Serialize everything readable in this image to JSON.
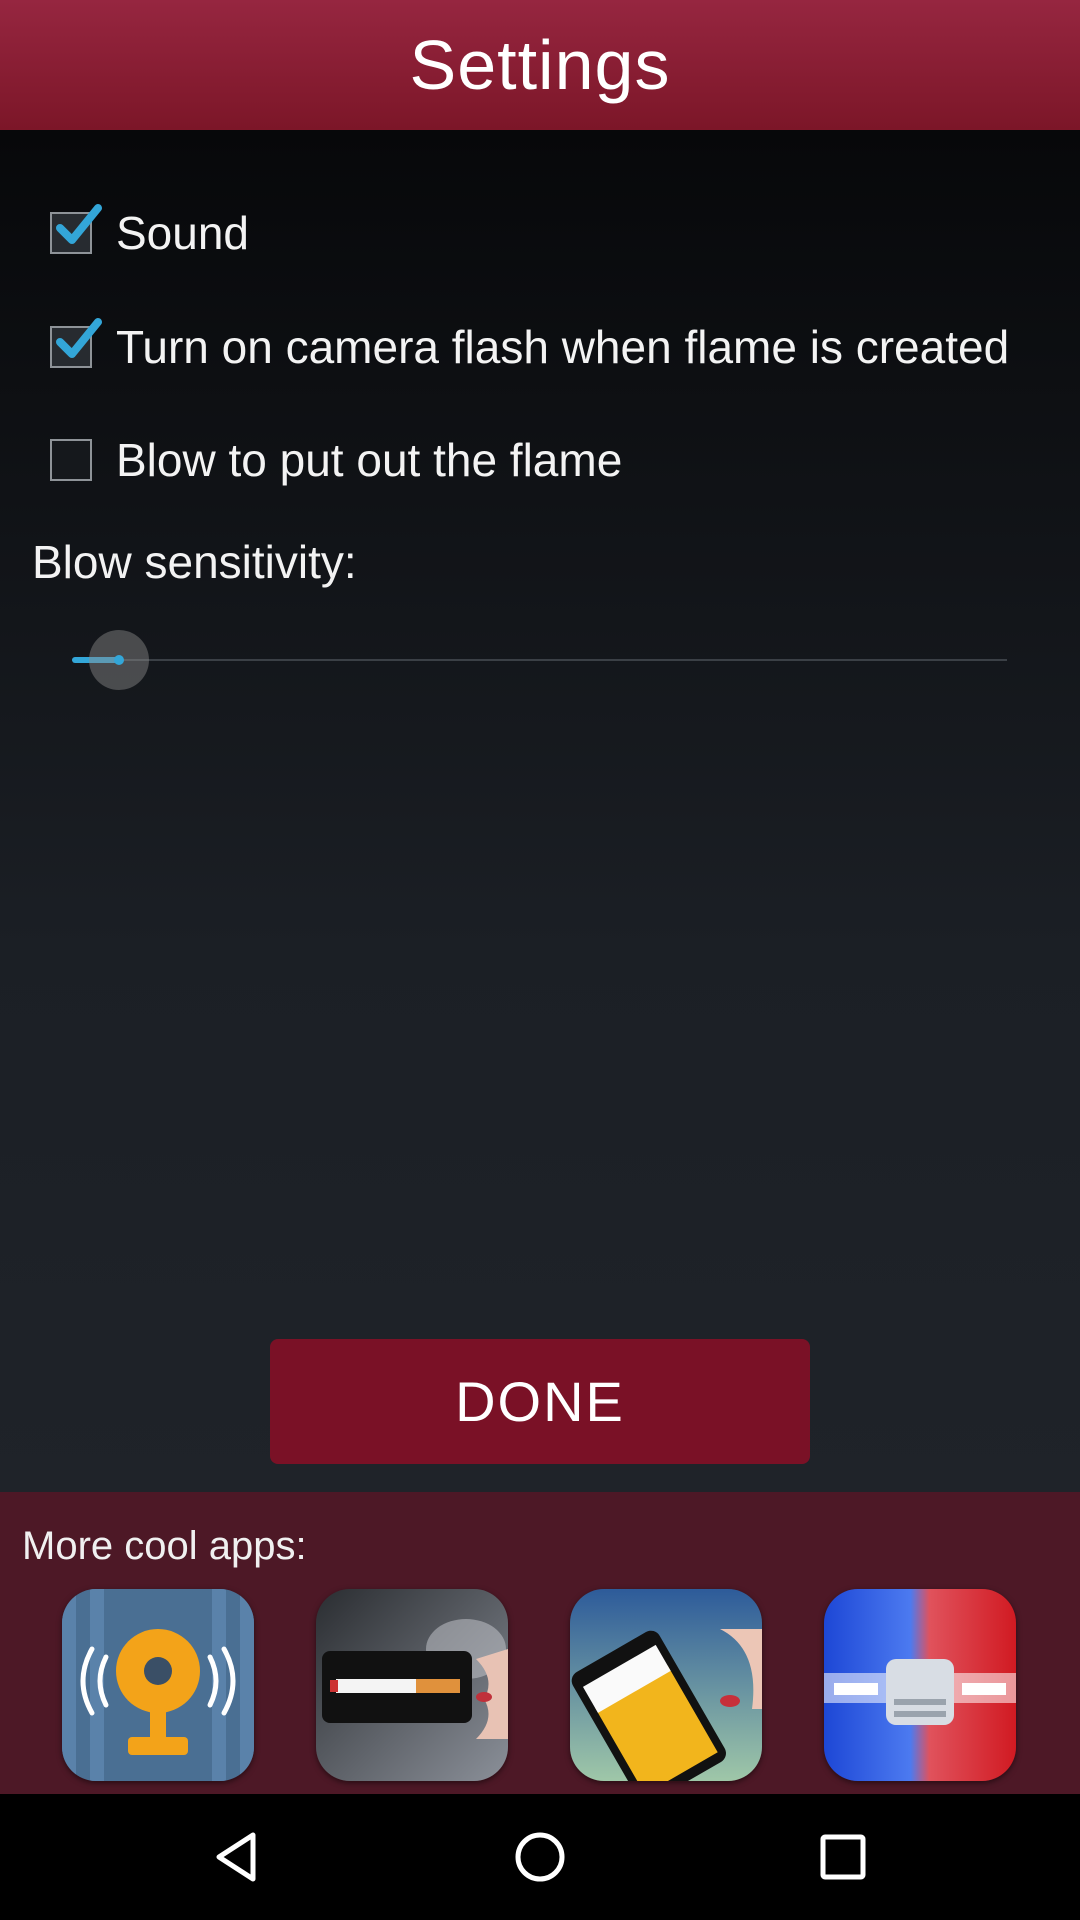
{
  "header": {
    "title": "Settings"
  },
  "options": [
    {
      "label": "Sound",
      "checked": true
    },
    {
      "label": "Turn on camera flash when flame is created",
      "checked": true
    },
    {
      "label": "Blow to put out the flame",
      "checked": false
    }
  ],
  "sensitivity": {
    "label": "Blow sensitivity:",
    "value_fraction": 0.05
  },
  "done_button": {
    "label": "DONE"
  },
  "promo": {
    "label": "More cool apps:",
    "apps": [
      {
        "icon": "alarm-bell-app-icon"
      },
      {
        "icon": "cigarette-app-icon"
      },
      {
        "icon": "beer-app-icon"
      },
      {
        "icon": "police-siren-app-icon"
      }
    ]
  },
  "navbar": {
    "back_icon": "back-triangle-icon",
    "home_icon": "home-circle-icon",
    "recents_icon": "recents-square-icon"
  },
  "colors": {
    "header": "#8a1f36",
    "accent": "#33a6d8",
    "button": "#7a1126",
    "promo_bg": "#4d1826"
  }
}
